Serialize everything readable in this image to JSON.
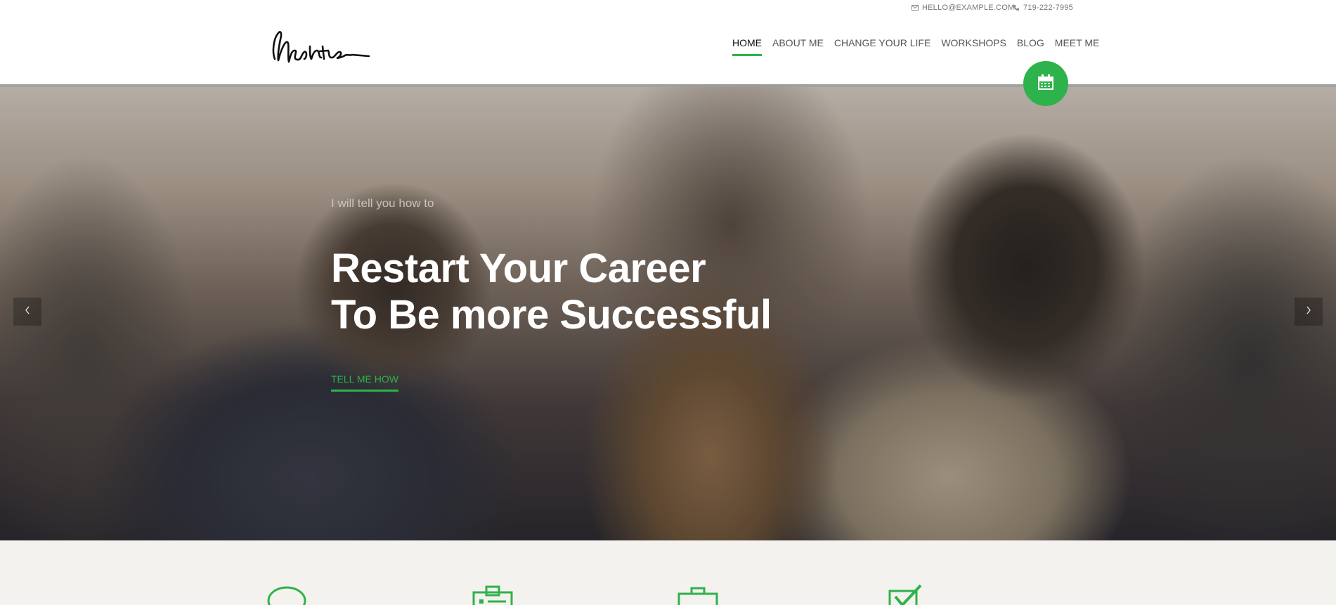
{
  "topbar": {
    "email": "HELLO@EXAMPLE.COM",
    "email_icon": "envelope-icon",
    "phone": "719-222-7995",
    "phone_icon": "phone-icon"
  },
  "header": {
    "logo_alt": "Mentor",
    "nav": [
      {
        "label": "HOME",
        "active": true
      },
      {
        "label": "ABOUT ME",
        "active": false
      },
      {
        "label": "CHANGE YOUR LIFE",
        "active": false
      },
      {
        "label": "WORKSHOPS",
        "active": false
      },
      {
        "label": "BLOG",
        "active": false
      },
      {
        "label": "MEET ME",
        "active": false
      }
    ],
    "calendar_icon": "calendar-icon"
  },
  "hero": {
    "pretitle": "I will tell you how to",
    "title_line1": "Restart Your Career",
    "title_line2": "To Be more Successful",
    "cta": "TELL ME HOW",
    "prev_icon": "chevron-left-icon",
    "next_icon": "chevron-right-icon"
  },
  "features": {
    "icons": [
      "speech-bubble-icon",
      "id-badge-icon",
      "briefcase-icon",
      "checkbox-icon"
    ]
  },
  "colors": {
    "accent": "#2eb24b",
    "nav_text": "#555555",
    "features_bg": "#f4f2ee"
  }
}
